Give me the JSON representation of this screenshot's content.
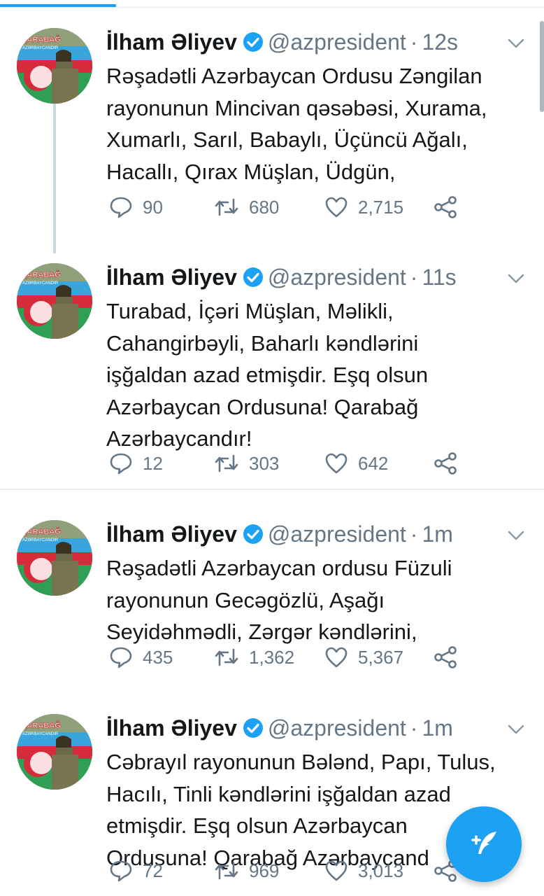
{
  "tweets": [
    {
      "name": "İlham Əliyev",
      "handle": "@azpresident",
      "time": "12s",
      "lines": [
        "Rəşadətli Azərbaycan Ordusu Zəngilan",
        "rayonunun Mincivan qəsəbəsi, Xurama,",
        "Xumarlı, Sarıl, Babaylı, Üçüncü Ağalı,",
        "Hacallı, Qırax Müşlan, Üdgün,"
      ],
      "replies": "90",
      "retweets": "680",
      "likes": "2,715"
    },
    {
      "name": "İlham Əliyev",
      "handle": "@azpresident",
      "time": "11s",
      "lines": [
        "Turabad, İçəri Müşlan, Məlikli,",
        "Cahangirbəyli, Baharlı kəndlərini",
        "işğaldan azad etmişdir. Eşq olsun",
        "Azərbaycan Ordusuna! Qarabağ",
        "Azərbaycandır!"
      ],
      "replies": "12",
      "retweets": "303",
      "likes": "642"
    },
    {
      "name": "İlham Əliyev",
      "handle": "@azpresident",
      "time": "1m",
      "lines": [
        "Rəşadətli Azərbaycan ordusu Füzuli",
        "rayonunun Gecəgözlü, Aşağı",
        "Seyidəhmədli, Zərgər kəndlərini,"
      ],
      "replies": "435",
      "retweets": "1,362",
      "likes": "5,367"
    },
    {
      "name": "İlham Əliyev",
      "handle": "@azpresident",
      "time": "1m",
      "lines": [
        "Cəbrayıl rayonunun Bələnd, Papı, Tulus,",
        "Hacılı, Tinli kəndlərini işğaldan azad",
        "etmişdir. Eşq olsun Azərbaycan",
        "Ordusuna! Qarabağ Azərbaycand"
      ],
      "replies": "72",
      "retweets": "969",
      "likes": "3,013"
    }
  ],
  "avatar_text": {
    "line1": "QARABAĞ",
    "line2": "AZƏRBAYCANDIR"
  },
  "colors": {
    "accent": "#1da1f2",
    "muted": "#657786",
    "divider": "#e6ecf0",
    "thread": "#ccd6dd"
  },
  "icons": {
    "reply": "reply-icon",
    "retweet": "retweet-icon",
    "like": "heart-icon",
    "share": "share-icon",
    "verified": "verified-badge-icon",
    "compose": "compose-tweet-icon"
  }
}
